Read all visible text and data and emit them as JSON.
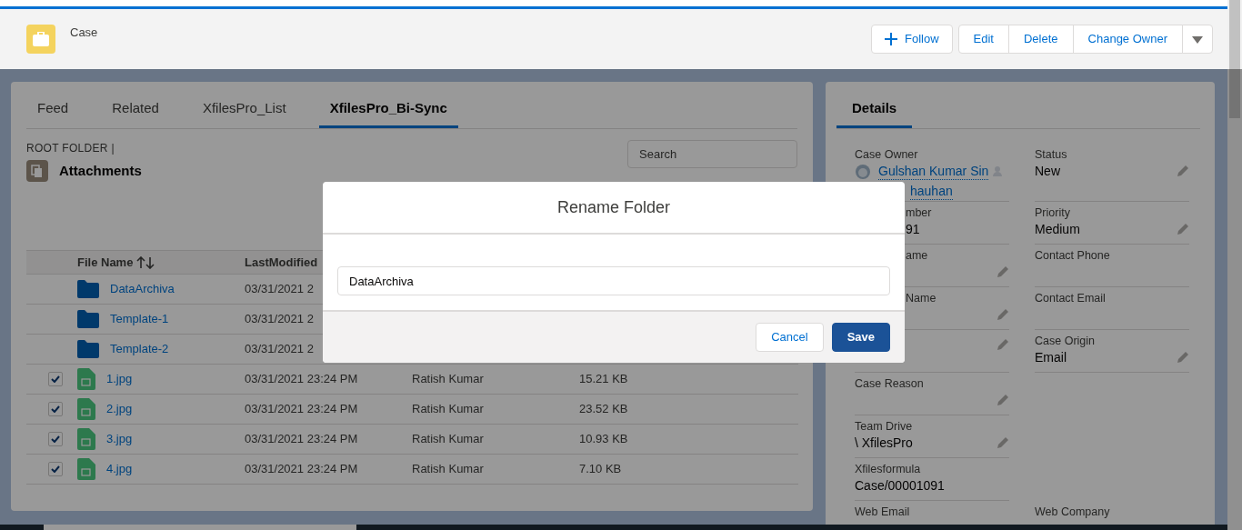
{
  "header": {
    "record_type": "Case",
    "follow": "Follow",
    "actions": [
      "Edit",
      "Delete",
      "Change Owner"
    ]
  },
  "tabs": [
    {
      "label": "Feed",
      "selected": false
    },
    {
      "label": "Related",
      "selected": false
    },
    {
      "label": "XfilesPro_List",
      "selected": false
    },
    {
      "label": "XfilesPro_Bi-Sync",
      "selected": true
    }
  ],
  "folder_path": "ROOT FOLDER |",
  "folder_name": "Attachments",
  "search": {
    "placeholder": "Search"
  },
  "table": {
    "columns": [
      "File Name",
      "LastModified"
    ],
    "rows": [
      {
        "kind": "folder",
        "name": "DataArchiva",
        "modified": "03/31/2021 2"
      },
      {
        "kind": "folder",
        "name": "Template-1",
        "modified": "03/31/2021 2"
      },
      {
        "kind": "folder",
        "name": "Template-2",
        "modified": "03/31/2021 2"
      },
      {
        "kind": "file",
        "checked": true,
        "name": "1.jpg",
        "modified": "03/31/2021 23:24 PM",
        "owner": "Ratish Kumar",
        "size": "15.21 KB"
      },
      {
        "kind": "file",
        "checked": true,
        "name": "2.jpg",
        "modified": "03/31/2021 23:24 PM",
        "owner": "Ratish Kumar",
        "size": "23.52 KB"
      },
      {
        "kind": "file",
        "checked": true,
        "name": "3.jpg",
        "modified": "03/31/2021 23:24 PM",
        "owner": "Ratish Kumar",
        "size": "10.93 KB"
      },
      {
        "kind": "file",
        "checked": true,
        "name": "4.jpg",
        "modified": "03/31/2021 23:24 PM",
        "owner": "Ratish Kumar",
        "size": "7.10 KB"
      }
    ]
  },
  "details": {
    "tabs": [
      {
        "label": "Details",
        "selected": true
      }
    ],
    "rows": [
      [
        {
          "kind": "owner",
          "label": "Case Owner",
          "value": "Gulshan Kumar Sin",
          "value_cont": "hauhan"
        },
        {
          "kind": "text",
          "label": "Status",
          "value": "New",
          "editable": true
        }
      ],
      [
        {
          "kind": "text",
          "label": "mber",
          "value": "91",
          "covered": true,
          "editable": false
        },
        {
          "kind": "text",
          "label": "Priority",
          "value": "Medium",
          "editable": true
        }
      ],
      [
        {
          "kind": "text",
          "label": "ame",
          "covered": true,
          "editable": true
        },
        {
          "kind": "text",
          "label": "Contact Phone",
          "editable": false
        }
      ],
      [
        {
          "kind": "text",
          "label": "Name",
          "covered": true,
          "editable": true
        },
        {
          "kind": "text",
          "label": "Contact Email",
          "editable": false
        }
      ],
      [
        {
          "kind": "text",
          "editable": true
        },
        {
          "kind": "text",
          "label": "Case Origin",
          "value": "Email",
          "editable": true
        }
      ],
      [
        {
          "kind": "text",
          "label": "Case Reason",
          "editable": true
        },
        null
      ],
      [
        {
          "kind": "text",
          "label": "Team Drive",
          "value": "\\ XfilesPro",
          "editable": true
        },
        null
      ],
      [
        {
          "kind": "text",
          "label": "Xfilesformula",
          "value": "Case/00001091",
          "editable": false
        },
        null
      ],
      [
        {
          "kind": "text",
          "label": "Web Email"
        },
        {
          "kind": "text",
          "label": "Web Company"
        }
      ]
    ]
  },
  "modal": {
    "title": "Rename Folder",
    "input_value": "DataArchiva",
    "buttons": [
      {
        "label": "Cancel",
        "kind": "neutral"
      },
      {
        "label": "Save",
        "kind": "brand"
      }
    ]
  }
}
